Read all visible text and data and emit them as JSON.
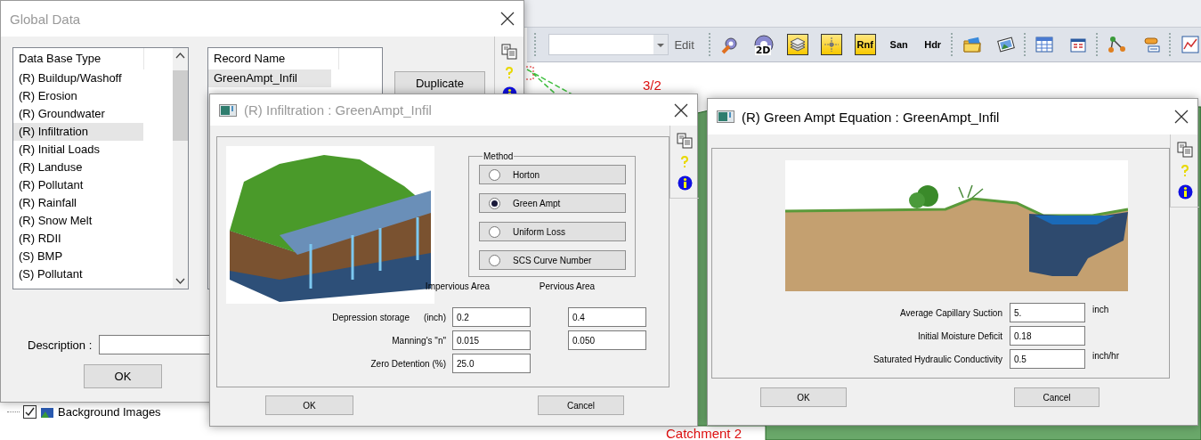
{
  "app": {
    "toolbar": {
      "edit_label": "Edit",
      "groups": [
        {
          "items": [
            {
              "kind": "icon",
              "on": false
            },
            {
              "kind": "icon-text",
              "label": "2D",
              "on": false
            },
            {
              "kind": "icon",
              "on": true
            },
            {
              "kind": "icon",
              "on": true
            },
            {
              "kind": "text",
              "label": "Rnf",
              "on": true
            },
            {
              "kind": "text",
              "label": "San",
              "on": false
            },
            {
              "kind": "text",
              "label": "Hdr",
              "on": false
            }
          ]
        },
        {
          "items": [
            {
              "kind": "icon",
              "on": false
            },
            {
              "kind": "icon",
              "on": false
            }
          ]
        },
        {
          "items": [
            {
              "kind": "icon",
              "on": false
            },
            {
              "kind": "icon",
              "on": false
            }
          ]
        },
        {
          "items": [
            {
              "kind": "icon",
              "on": false
            },
            {
              "kind": "icon",
              "on": false
            }
          ]
        },
        {
          "items": [
            {
              "kind": "icon",
              "on": false
            }
          ]
        }
      ]
    },
    "map_labels": [
      "3/2",
      "Catchment 2"
    ],
    "tree_item": {
      "label": "Background Images",
      "checked": true
    }
  },
  "global_data": {
    "title": "Global Data",
    "active": false,
    "type_list": {
      "header": "Data Base Type",
      "items": [
        {
          "label": "(R) Buildup/Washoff",
          "selected": false
        },
        {
          "label": "(R) Erosion",
          "selected": false
        },
        {
          "label": "(R) Groundwater",
          "selected": false
        },
        {
          "label": "(R) Infiltration",
          "selected": true
        },
        {
          "label": "(R) Initial Loads",
          "selected": false
        },
        {
          "label": "(R) Landuse",
          "selected": false
        },
        {
          "label": "(R) Pollutant",
          "selected": false
        },
        {
          "label": "(R) Rainfall",
          "selected": false
        },
        {
          "label": "(R) Snow Melt",
          "selected": false
        },
        {
          "label": "(R) RDII",
          "selected": false
        },
        {
          "label": "(S) BMP",
          "selected": false
        },
        {
          "label": "(S) Pollutant",
          "selected": false
        }
      ]
    },
    "record_list": {
      "header": "Record Name",
      "items": [
        {
          "label": "GreenAmpt_Infil",
          "selected": true
        }
      ]
    },
    "duplicate_button": "Duplicate",
    "description_label": "Description :",
    "ok_button": "OK"
  },
  "infiltration_dialog": {
    "title": "(R) Infiltration : GreenAmpt_Infil",
    "active": false,
    "method_label": "Method",
    "methods": [
      {
        "label": "Horton",
        "selected": false
      },
      {
        "label": "Green Ampt",
        "selected": true
      },
      {
        "label": "Uniform Loss",
        "selected": false
      },
      {
        "label": "SCS Curve Number",
        "selected": false
      }
    ],
    "columns": [
      "Impervious Area",
      "Pervious Area"
    ],
    "rows": [
      {
        "label": "Depression storage",
        "unit": "(inch)",
        "impervious": "0.2",
        "pervious": "0.4"
      },
      {
        "label": "Manning's \"n\"",
        "impervious": "0.015",
        "pervious": "0.050"
      },
      {
        "label": "Zero Detention (%)",
        "impervious": "25.0"
      }
    ],
    "buttons": [
      "OK",
      "Cancel"
    ]
  },
  "green_ampt_dialog": {
    "title": "(R) Green Ampt Equation : GreenAmpt_Infil",
    "active": true,
    "rows": [
      {
        "label": "Average Capillary Suction",
        "value": "5.",
        "unit": "inch"
      },
      {
        "label": "Initial Moisture Deficit",
        "value": "0.18"
      },
      {
        "label": "Saturated Hydraulic Conductivity",
        "value": "0.5",
        "unit": "inch/hr"
      }
    ],
    "buttons": [
      "OK",
      "Cancel"
    ]
  }
}
